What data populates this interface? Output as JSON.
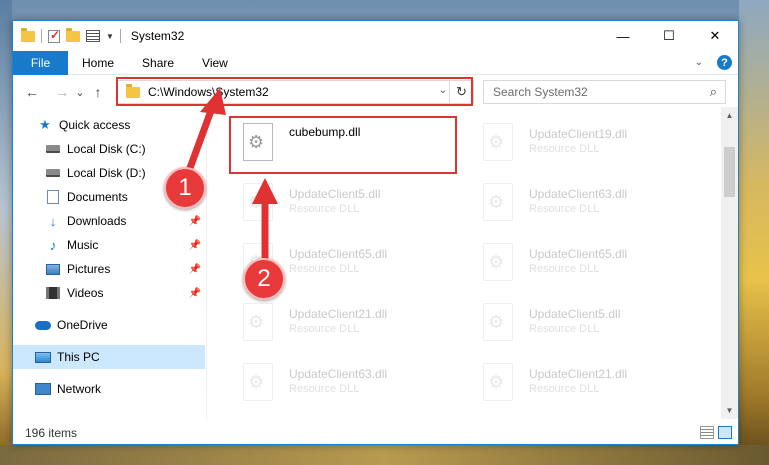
{
  "window": {
    "title": "System32",
    "controls": {
      "minimize": "—",
      "maximize": "☐",
      "close": "✕"
    }
  },
  "ribbon": {
    "tabs": [
      "File",
      "Home",
      "Share",
      "View"
    ]
  },
  "nav": {
    "back": "←",
    "forward": "→",
    "recent": "⌄",
    "up": "↑",
    "address": "C:\\Windows\\System32",
    "search_placeholder": "Search System32"
  },
  "sidebar": {
    "items": [
      {
        "label": "Quick access",
        "icon": "star-icon"
      },
      {
        "label": "Local Disk (C:)",
        "icon": "drive-icon"
      },
      {
        "label": "Local Disk (D:)",
        "icon": "drive-icon"
      },
      {
        "label": "Documents",
        "icon": "documents-icon"
      },
      {
        "label": "Downloads",
        "icon": "download-icon",
        "pinned": true
      },
      {
        "label": "Music",
        "icon": "music-icon",
        "pinned": true
      },
      {
        "label": "Pictures",
        "icon": "pictures-icon",
        "pinned": true
      },
      {
        "label": "Videos",
        "icon": "videos-icon",
        "pinned": true
      },
      {
        "label": "OneDrive",
        "icon": "cloud-icon"
      },
      {
        "label": "This PC",
        "icon": "computer-icon",
        "selected": true
      },
      {
        "label": "Network",
        "icon": "network-icon"
      }
    ]
  },
  "files": [
    {
      "name": "cubebump.dll",
      "type": ""
    },
    {
      "name": "UpdateClient19.dll",
      "type": "Resource DLL"
    },
    {
      "name": "UpdateClient5.dll",
      "type": "Resource DLL"
    },
    {
      "name": "UpdateClient63.dll",
      "type": "Resource DLL"
    },
    {
      "name": "UpdateClient65.dll",
      "type": "Resource DLL"
    },
    {
      "name": "UpdateClient65.dll",
      "type": "Resource DLL"
    },
    {
      "name": "UpdateClient21.dll",
      "type": "Resource DLL"
    },
    {
      "name": "UpdateClient5.dll",
      "type": "Resource DLL"
    },
    {
      "name": "UpdateClient63.dll",
      "type": "Resource DLL"
    },
    {
      "name": "UpdateClient21.dll",
      "type": "Resource DLL"
    }
  ],
  "status": {
    "item_count": "196 items"
  },
  "annotations": {
    "step1": "1",
    "step2": "2"
  },
  "colors": {
    "accent": "#1979ca",
    "annotation": "#e03232",
    "selected": "#cce8ff"
  }
}
